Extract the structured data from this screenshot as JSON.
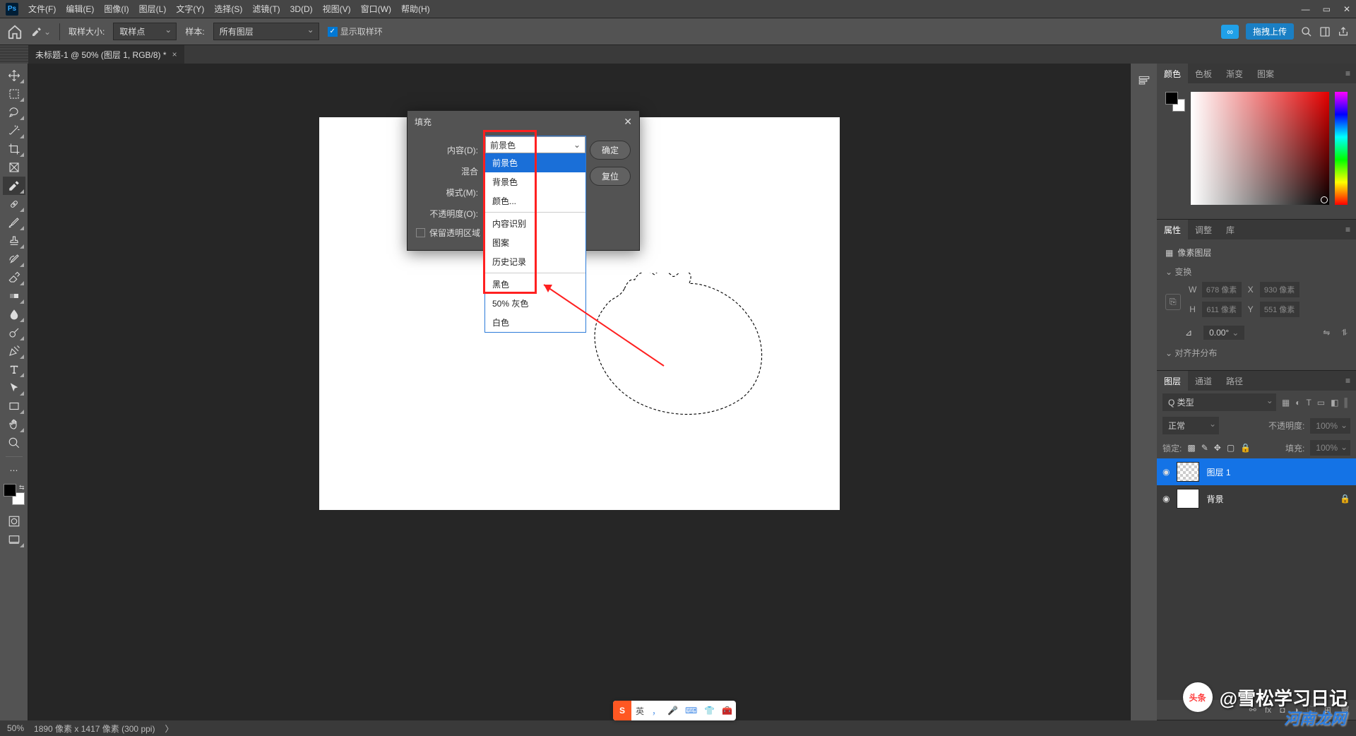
{
  "app": {
    "logo": "Ps"
  },
  "menus": [
    "文件(F)",
    "编辑(E)",
    "图像(I)",
    "图层(L)",
    "文字(Y)",
    "选择(S)",
    "滤镜(T)",
    "3D(D)",
    "视图(V)",
    "窗口(W)",
    "帮助(H)"
  ],
  "options": {
    "sample_size_label": "取样大小:",
    "sample_size_value": "取样点",
    "sample_label": "样本:",
    "sample_value": "所有图层",
    "show_ring": "显示取样环",
    "cloud_icon": "☁",
    "upload": "拖拽上传"
  },
  "doc_tab": {
    "title": "未标题-1 @ 50% (图层 1, RGB/8) *"
  },
  "dialog": {
    "title": "填充",
    "content_label": "内容(D):",
    "content_value": "前景色",
    "blend_label": "混合",
    "mode_label": "模式(M):",
    "opacity_label": "不透明度(O):",
    "preserve": "保留透明区域",
    "ok": "确定",
    "reset": "复位"
  },
  "dropdown": {
    "items_a": [
      "前景色",
      "背景色",
      "颜色..."
    ],
    "items_b": [
      "内容识别",
      "图案",
      "历史记录"
    ],
    "items_c": [
      "黑色",
      "50% 灰色",
      "白色"
    ]
  },
  "panels": {
    "color_tabs": [
      "颜色",
      "色板",
      "渐变",
      "图案"
    ],
    "props_tabs": [
      "属性",
      "调整",
      "库"
    ],
    "props": {
      "title_icon": "▦",
      "title": "像素图层",
      "section_transform": "变换",
      "w": "W",
      "w_val": "678 像素",
      "h": "H",
      "h_val": "611 像素",
      "x": "X",
      "x_val": "930 像素",
      "y": "Y",
      "y_val": "551 像素",
      "angle": "0.00°",
      "section_align": "对齐并分布"
    },
    "layers_tabs": [
      "图层",
      "通道",
      "路径"
    ],
    "layers": {
      "kind": "Q 类型",
      "blend": "正常",
      "opacity_label": "不透明度:",
      "opacity_value": "100%",
      "lock_label": "锁定:",
      "fill_label": "填充:",
      "fill_value": "100%",
      "rows": [
        {
          "name": "图层 1",
          "trans": true,
          "locked": false
        },
        {
          "name": "背景",
          "trans": false,
          "locked": true
        }
      ]
    }
  },
  "status": {
    "zoom": "50%",
    "doc": "1890 像素 x 1417 像素 (300 ppi)",
    "arrow": "〉"
  },
  "watermark": {
    "badge": "头",
    "badge2": "条",
    "at": "@雪松学习日记",
    "site": "河南龙网"
  },
  "ime": {
    "s": "S",
    "lang": "英",
    "punc": "，"
  }
}
